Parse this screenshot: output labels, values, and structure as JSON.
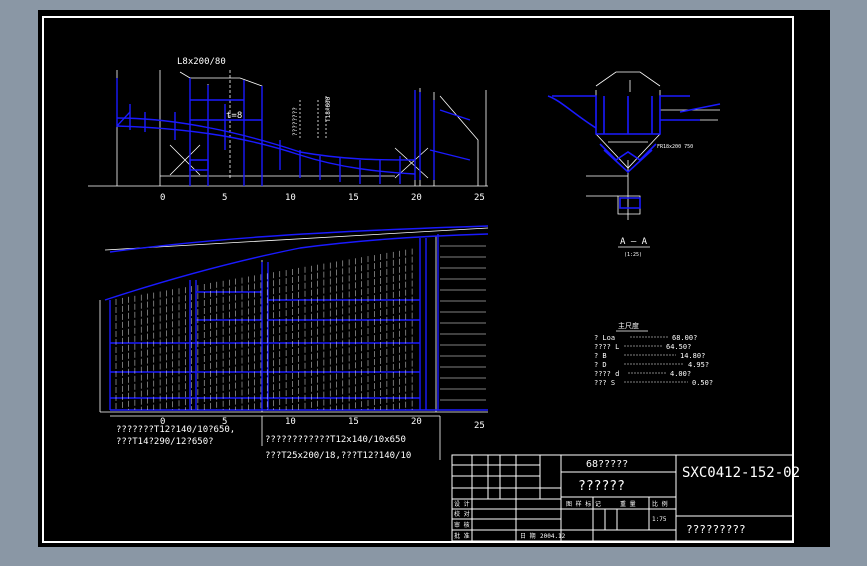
{
  "colors": {
    "backdrop": "#8a97a5",
    "sheet": "#000000",
    "border": "#ffffff",
    "structure": "#1a1aff",
    "ink": "#ffffff"
  },
  "profile": {
    "label_top": "L8x200/80",
    "label_t": "t=8",
    "dims_vertical": [
      "????????",
      "T18×600"
    ],
    "ticks": [
      "0",
      "5",
      "10",
      "15",
      "20",
      "25"
    ]
  },
  "plan": {
    "ticks": [
      "0",
      "5",
      "10",
      "15",
      "20",
      "25"
    ],
    "note_left": [
      "???????T12?140/10?650,",
      "???T14?290/12?650?"
    ],
    "note_mid": "????????????T12x140/10x650",
    "note_bottom": "???T25x200/18,???T12?140/10"
  },
  "section": {
    "title": "A — A",
    "scale": "(1:25)",
    "label_right": "FR18x200 750"
  },
  "particulars": {
    "heading": "主尺度",
    "rows": [
      {
        "label": "?  Loa",
        "value": "68.00?"
      },
      {
        "label": "????  L",
        "value": "64.50?"
      },
      {
        "label": "?  B",
        "value": "14.80?"
      },
      {
        "label": "?  D",
        "value": "4.95?"
      },
      {
        "label": "????  d",
        "value": "4.00?"
      },
      {
        "label": "???  S",
        "value": "0.50?"
      }
    ]
  },
  "title_block": {
    "project": "68?????",
    "drawing_name": "??????",
    "drawing_no": "SXC0412-152-02",
    "company": "?????????",
    "scale": "1:75",
    "roles": [
      "设 计",
      "校 对",
      "审 核",
      "批 准"
    ],
    "col_headers": [
      "图 样 标 记",
      "重 量",
      "比 例"
    ],
    "date_label": "日 期",
    "date_value": "2004.12"
  }
}
